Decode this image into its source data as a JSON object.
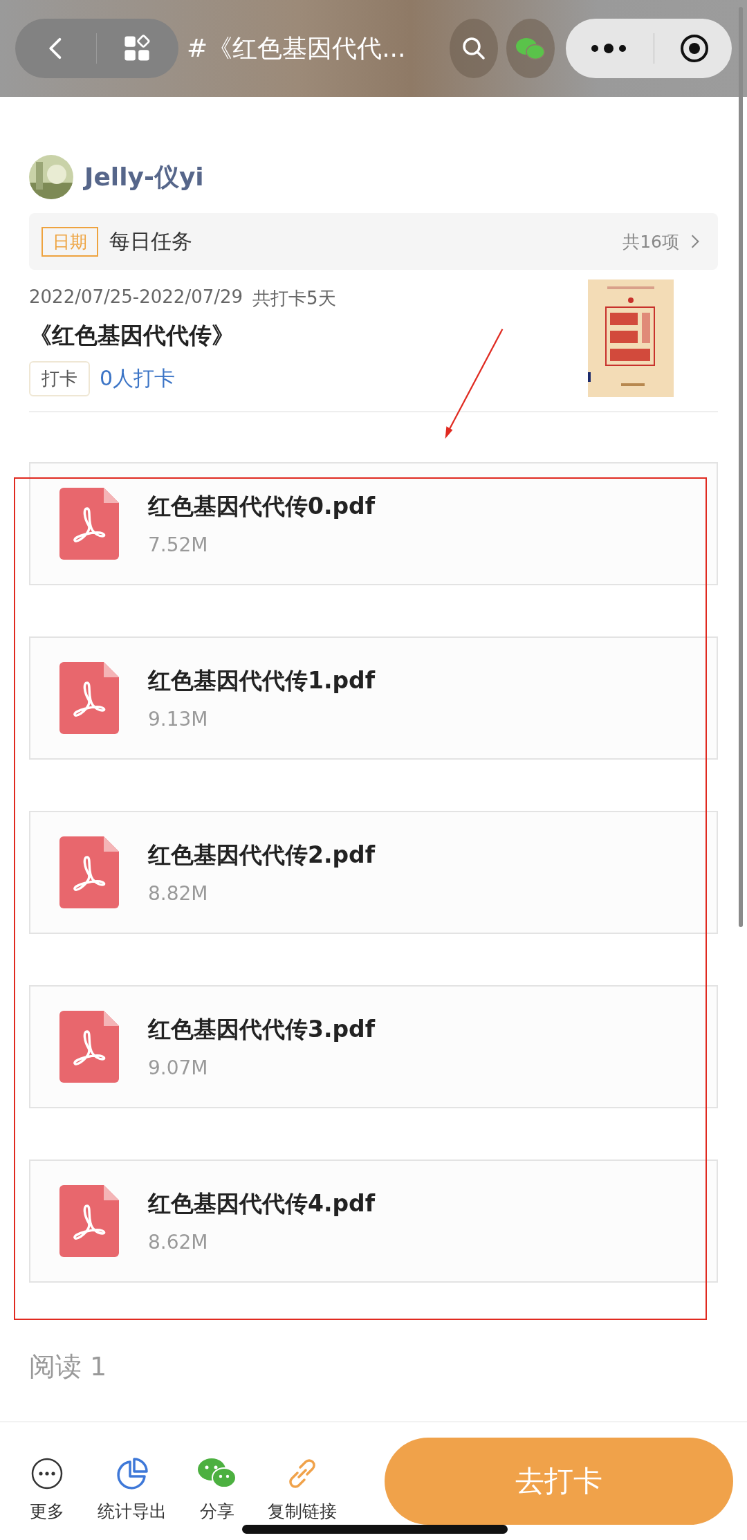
{
  "nav_bar": {
    "title": "#《红色基因代代..."
  },
  "author": {
    "name": "Jelly-仪yi"
  },
  "task_banner": {
    "tag": "日期",
    "title": "每日任务",
    "count": "共16项"
  },
  "task": {
    "dates": "2022/07/25-2022/07/29",
    "days": "共打卡5天",
    "title": "《红色基因代代传》",
    "tag": "打卡",
    "participants": "0人打卡"
  },
  "files": [
    {
      "name": "红色基因代代传0.pdf",
      "size": "7.52M"
    },
    {
      "name": "红色基因代代传1.pdf",
      "size": "9.13M"
    },
    {
      "name": "红色基因代代传2.pdf",
      "size": "8.82M"
    },
    {
      "name": "红色基因代代传3.pdf",
      "size": "9.07M"
    },
    {
      "name": "红色基因代代传4.pdf",
      "size": "8.62M"
    }
  ],
  "reads": "阅读 1",
  "toolbar": [
    {
      "kind": "more",
      "label": "更多"
    },
    {
      "kind": "stats",
      "label": "统计导出"
    },
    {
      "kind": "share",
      "label": "分享"
    },
    {
      "kind": "link",
      "label": "复制链接"
    }
  ],
  "primary_button": "去打卡"
}
